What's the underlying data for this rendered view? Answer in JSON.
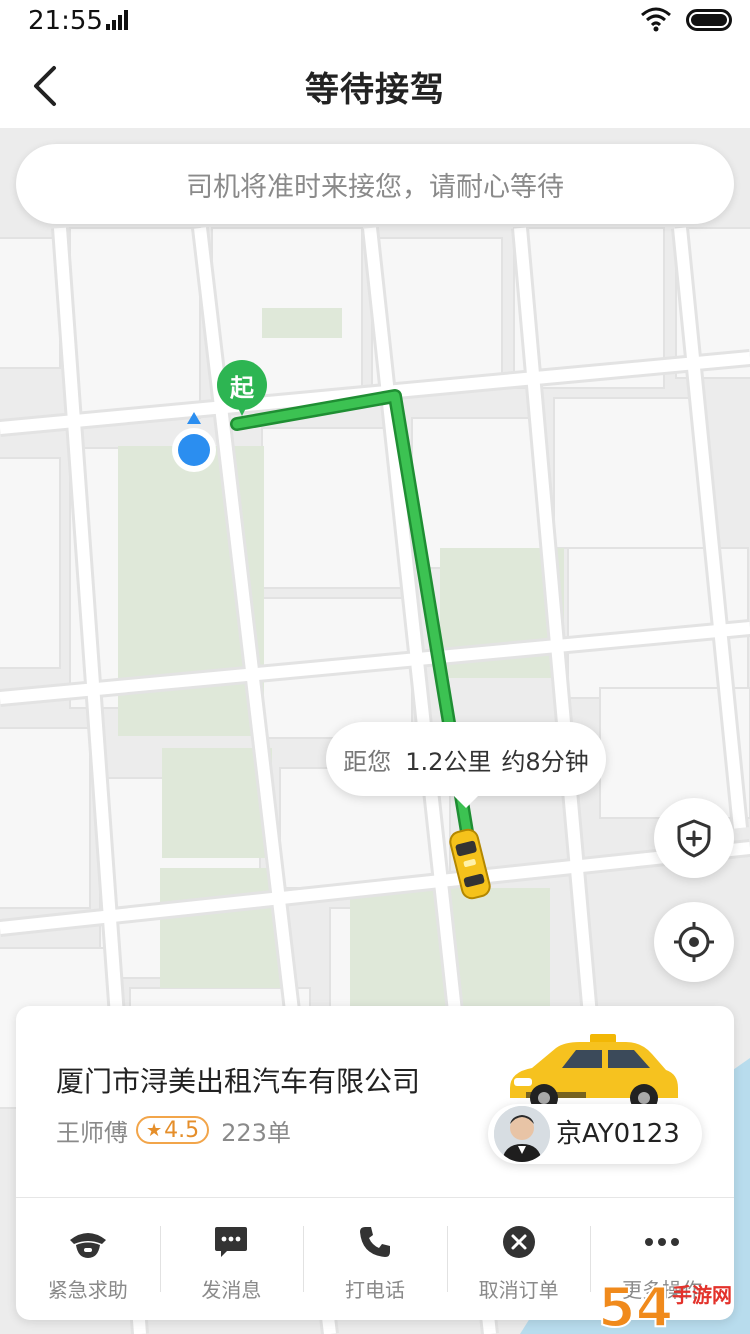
{
  "status_bar": {
    "time": "21:55"
  },
  "header": {
    "title": "等待接驾"
  },
  "map": {
    "hint": "司机将准时来接您，请耐心等待",
    "start_marker": "起",
    "eta": {
      "prefix": "距您",
      "distance": "1.2公里",
      "time": "约8分钟"
    }
  },
  "driver_card": {
    "company": "厦门市浔美出租汽车有限公司",
    "driver_name": "王师傅",
    "rating": "4.5",
    "orders": "223单",
    "plate": "京AY0123"
  },
  "actions": [
    {
      "label": "紧急求助",
      "icon": "police-icon"
    },
    {
      "label": "发消息",
      "icon": "message-icon"
    },
    {
      "label": "打电话",
      "icon": "phone-icon"
    },
    {
      "label": "取消订单",
      "icon": "cancel-icon"
    },
    {
      "label": "更多操作",
      "icon": "more-icon"
    }
  ],
  "colors": {
    "route": "#3cc252",
    "start": "#2db552",
    "rating": "#e58e2a",
    "location": "#2b8ef0"
  },
  "watermark": {
    "digits": "54",
    "text": "手游网"
  }
}
